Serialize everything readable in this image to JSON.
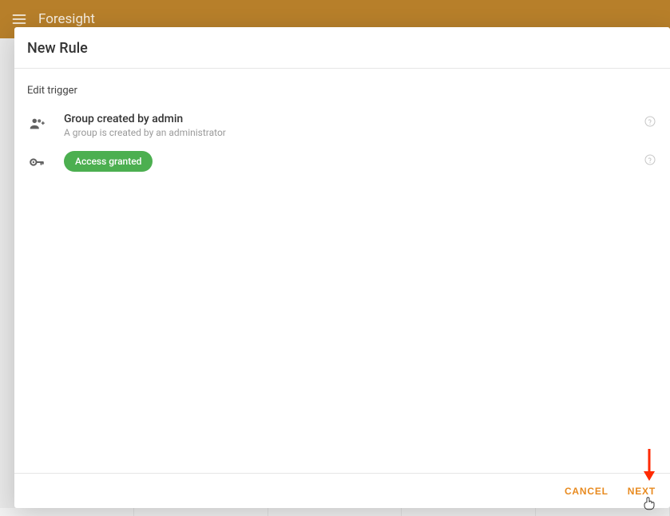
{
  "app": {
    "title": "Foresight"
  },
  "dialog": {
    "title": "New Rule",
    "section_label": "Edit trigger",
    "trigger_rows": [
      {
        "icon": "group-add-icon",
        "title": "Group created by admin",
        "subtitle": "A group is created by an administrator",
        "chip": null
      },
      {
        "icon": "key-icon",
        "title": null,
        "subtitle": null,
        "chip": "Access granted"
      }
    ],
    "footer": {
      "cancel": "CANCEL",
      "next": "NEXT"
    }
  }
}
